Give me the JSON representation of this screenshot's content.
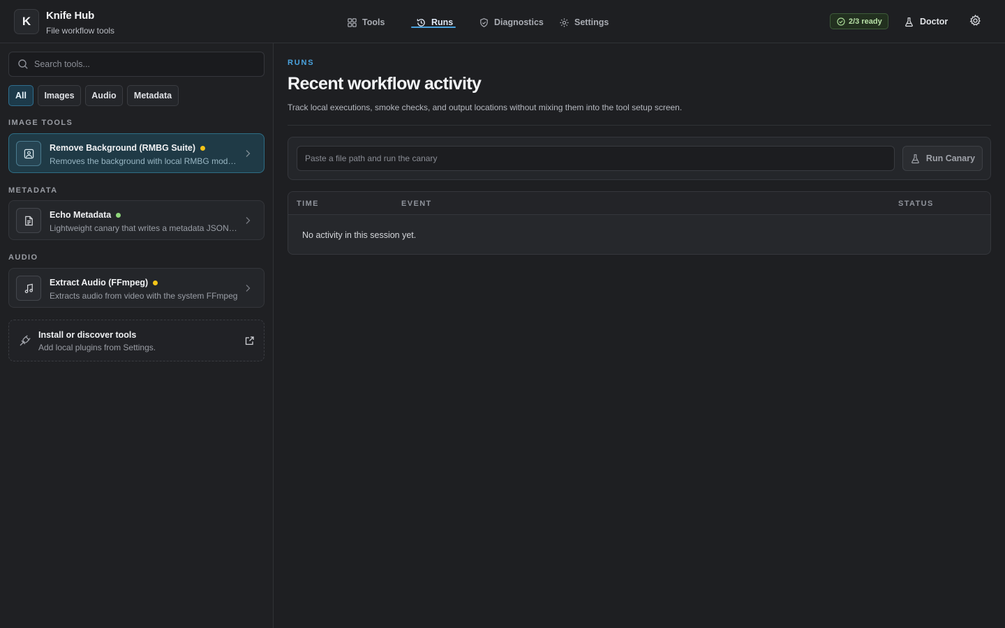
{
  "app": {
    "logo_letter": "K",
    "title": "Knife Hub",
    "subtitle": "File workflow tools"
  },
  "nav": {
    "items": [
      {
        "label": "Tools",
        "icon": "grid-icon",
        "active": false
      },
      {
        "label": "Runs",
        "icon": "history-icon",
        "active": true
      },
      {
        "label": "Diagnostics",
        "icon": "shield-check-icon",
        "active": false
      },
      {
        "label": "Settings",
        "icon": "gear-icon",
        "active": false
      }
    ]
  },
  "header": {
    "ready_badge": "2/3 ready",
    "doctor_label": "Doctor"
  },
  "sidebar": {
    "search_placeholder": "Search tools...",
    "filters": [
      {
        "label": "All",
        "active": true
      },
      {
        "label": "Images",
        "active": false
      },
      {
        "label": "Audio",
        "active": false
      },
      {
        "label": "Metadata",
        "active": false
      }
    ],
    "sections": [
      {
        "label": "IMAGE TOOLS",
        "tools": [
          {
            "name": "Remove Background (RMBG Suite)",
            "description": "Removes the background with local RMBG models",
            "status": "yellow",
            "icon": "image-icon",
            "active": true
          }
        ]
      },
      {
        "label": "METADATA",
        "tools": [
          {
            "name": "Echo Metadata",
            "description": "Lightweight canary that writes a metadata JSON file",
            "status": "green",
            "icon": "document-icon",
            "active": false
          }
        ]
      },
      {
        "label": "AUDIO",
        "tools": [
          {
            "name": "Extract Audio (FFmpeg)",
            "description": "Extracts audio from video with the system FFmpeg",
            "status": "yellow",
            "icon": "music-icon",
            "active": false
          }
        ]
      }
    ],
    "install": {
      "title": "Install or discover tools",
      "subtitle": "Add local plugins from Settings."
    }
  },
  "main": {
    "eyebrow": "RUNS",
    "title": "Recent workflow activity",
    "description": "Track local executions, smoke checks, and output locations without mixing them into the tool setup screen.",
    "canary_placeholder": "Paste a file path and run the canary",
    "run_button": "Run Canary",
    "table": {
      "columns": [
        "TIME",
        "EVENT",
        "STATUS"
      ],
      "empty_message": "No activity in this session yet."
    }
  },
  "colors": {
    "accent": "#4aa3df",
    "status_yellow": "#f5c518",
    "status_green": "#8fd67a",
    "background": "#1e1f22"
  }
}
